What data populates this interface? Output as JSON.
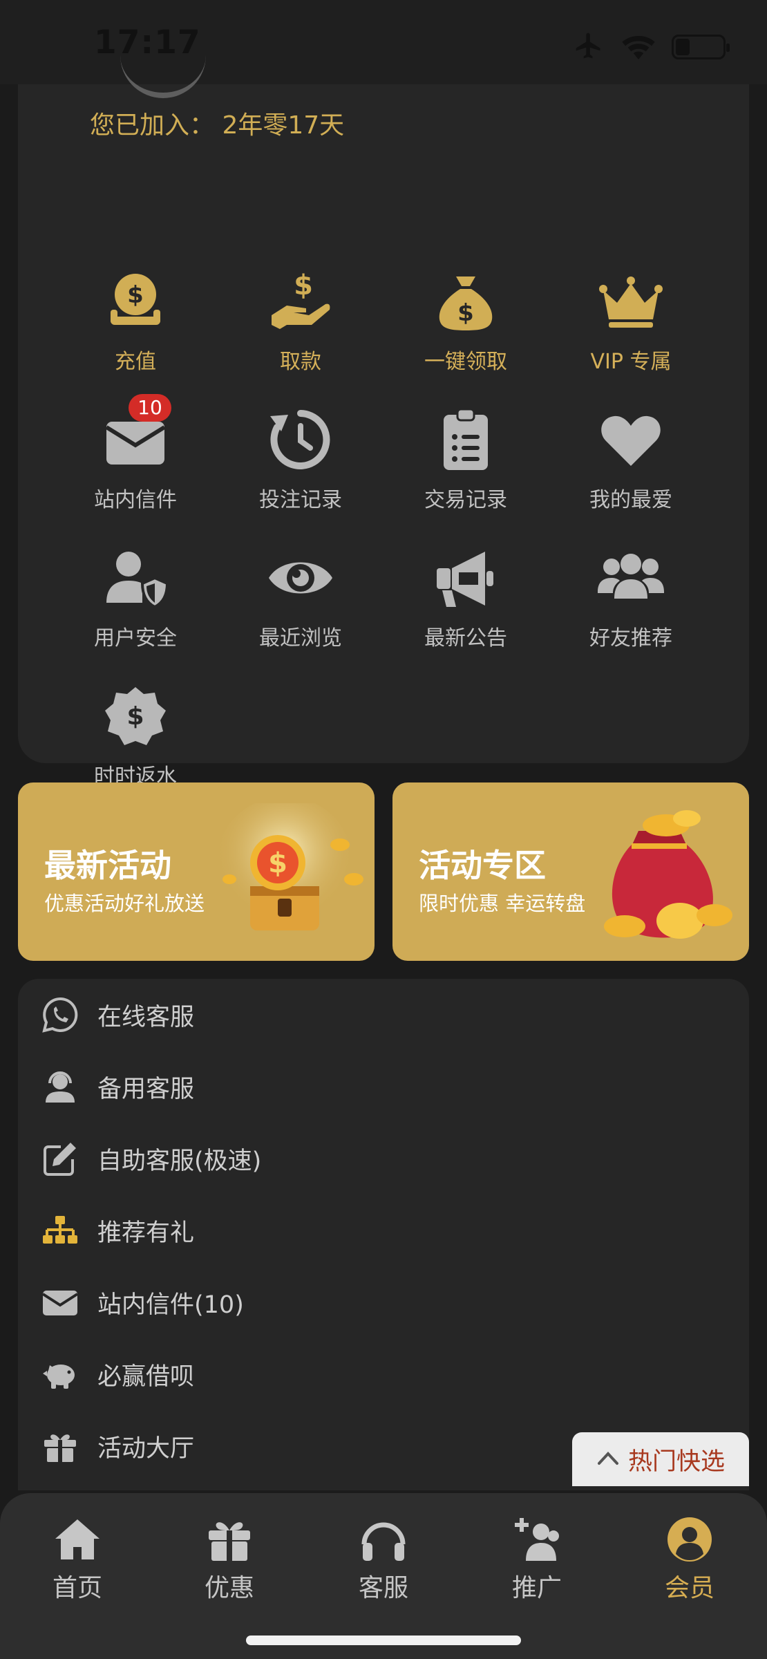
{
  "status": {
    "time": "17:17"
  },
  "profile": {
    "joined_text": "您已加入： 2年零17天"
  },
  "grid": [
    {
      "label": "充值",
      "icon": "coin-deposit-icon",
      "gold": true
    },
    {
      "label": "取款",
      "icon": "hand-dollar-icon",
      "gold": true
    },
    {
      "label": "一键领取",
      "icon": "money-bag-icon",
      "gold": true
    },
    {
      "label": "VIP 专属",
      "icon": "crown-icon",
      "gold": true
    },
    {
      "label": "站内信件",
      "icon": "envelope-icon",
      "badge": "10"
    },
    {
      "label": "投注记录",
      "icon": "history-icon"
    },
    {
      "label": "交易记录",
      "icon": "clipboard-list-icon"
    },
    {
      "label": "我的最爱",
      "icon": "heart-icon"
    },
    {
      "label": "用户安全",
      "icon": "user-shield-icon"
    },
    {
      "label": "最近浏览",
      "icon": "eye-icon"
    },
    {
      "label": "最新公告",
      "icon": "megaphone-icon"
    },
    {
      "label": "好友推荐",
      "icon": "users-icon"
    },
    {
      "label": "时时返水",
      "icon": "dollar-badge-icon"
    }
  ],
  "banners": [
    {
      "title": "最新活动",
      "subtitle": "优惠活动好礼放送"
    },
    {
      "title": "活动专区",
      "subtitle": "限时优惠 幸运转盘"
    }
  ],
  "list": [
    {
      "label": "在线客服",
      "icon": "whatsapp-icon"
    },
    {
      "label": "备用客服",
      "icon": "headset-agent-icon"
    },
    {
      "label": "自助客服(极速)",
      "icon": "edit-icon"
    },
    {
      "label": "推荐有礼",
      "icon": "sitemap-icon"
    },
    {
      "label": "站内信件(10)",
      "icon": "envelope-icon"
    },
    {
      "label": "必赢借呗",
      "icon": "piggy-bank-icon"
    },
    {
      "label": "活动大厅",
      "icon": "gift-icon"
    }
  ],
  "hot_button": {
    "label": "热门快选"
  },
  "nav": [
    {
      "label": "首页",
      "icon": "home-icon"
    },
    {
      "label": "优惠",
      "icon": "gift-icon"
    },
    {
      "label": "客服",
      "icon": "headphones-icon"
    },
    {
      "label": "推广",
      "icon": "user-plus-icon"
    },
    {
      "label": "会员",
      "icon": "user-circle-icon",
      "active": true
    }
  ],
  "colors": {
    "gold": "#d1ae55",
    "background": "#1b1b1b",
    "card": "#262626",
    "badge": "#d42c27"
  }
}
